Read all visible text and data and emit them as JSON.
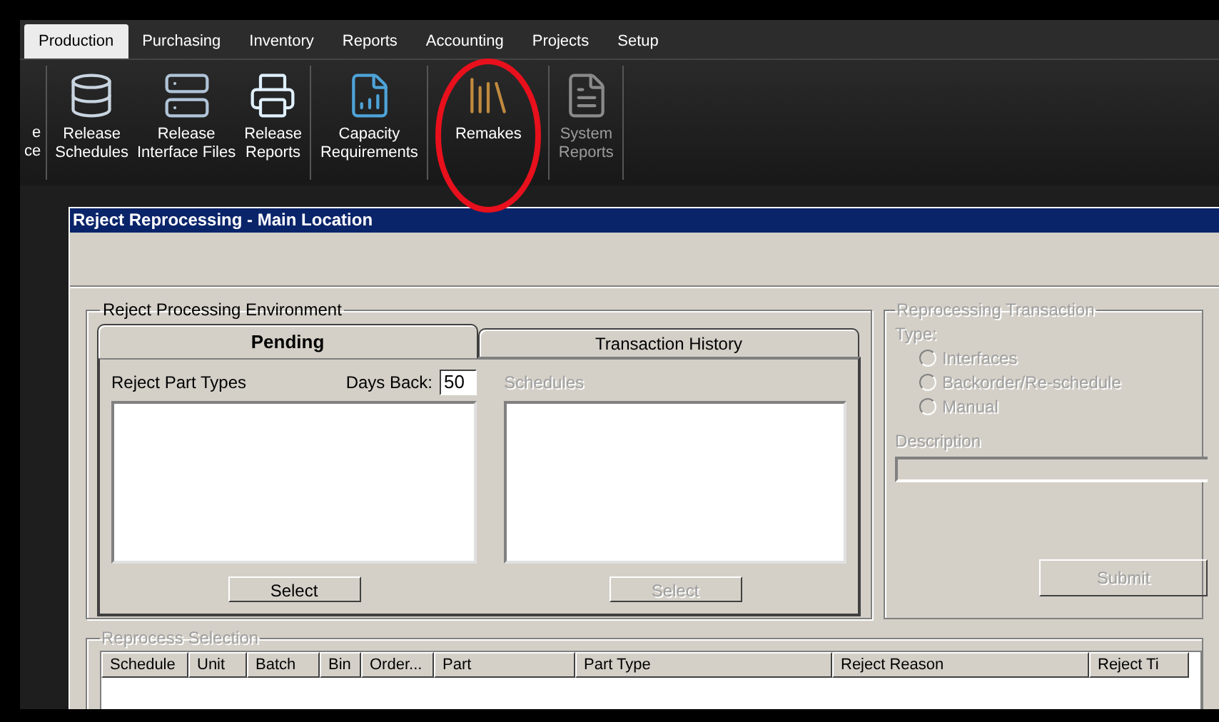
{
  "menu_tabs": [
    {
      "label": "Production",
      "selected": true
    },
    {
      "label": "Purchasing",
      "selected": false
    },
    {
      "label": "Inventory",
      "selected": false
    },
    {
      "label": "Reports",
      "selected": false
    },
    {
      "label": "Accounting",
      "selected": false
    },
    {
      "label": "Projects",
      "selected": false
    },
    {
      "label": "Setup",
      "selected": false
    }
  ],
  "toolbar_groups": [
    [
      {
        "kind": "cut",
        "lines": [
          "e",
          "ce"
        ],
        "disabled": false
      }
    ],
    [
      {
        "kind": "database",
        "lines": [
          "Release",
          "Schedules"
        ],
        "disabled": false
      },
      {
        "kind": "server",
        "lines": [
          "Release",
          "Interface Files"
        ],
        "disabled": false
      },
      {
        "kind": "printer",
        "lines": [
          "Release",
          "Reports"
        ],
        "disabled": false
      }
    ],
    [
      {
        "kind": "chart",
        "lines": [
          "Capacity",
          "Requirements"
        ],
        "disabled": false
      }
    ],
    [
      {
        "kind": "shelf",
        "lines": [
          "Remakes"
        ],
        "disabled": false,
        "circled": true
      }
    ],
    [
      {
        "kind": "document",
        "lines": [
          "System",
          "Reports"
        ],
        "disabled": true
      }
    ]
  ],
  "window": {
    "title": "Reject Reprocessing - Main Location",
    "environment": {
      "legend": "Reject Processing Environment",
      "tabs": [
        {
          "label": "Pending",
          "selected": true
        },
        {
          "label": "Transaction History",
          "selected": false
        }
      ],
      "part_types_label": "Reject Part Types",
      "days_back": {
        "label": "Days Back:",
        "value": "50"
      },
      "schedules_label": "Schedules",
      "schedules_disabled": true,
      "buttons": [
        {
          "label": "Select",
          "disabled": false
        },
        {
          "label": "Select",
          "disabled": true
        }
      ]
    },
    "transaction": {
      "legend": "Reprocessing Transaction",
      "disabled": true,
      "type_label": "Type:",
      "radios": [
        {
          "label": "Interfaces",
          "selected": false
        },
        {
          "label": "Backorder/Re-schedule",
          "selected": false
        },
        {
          "label": "Manual",
          "selected": false
        }
      ],
      "description_label": "Description",
      "submit": {
        "label": "Submit",
        "disabled": true
      }
    },
    "selection": {
      "legend": "Reprocess Selection",
      "disabled": true,
      "columns": [
        "Schedule",
        "Unit",
        "Batch",
        "Bin",
        "Order...",
        "Part",
        "Part Type",
        "Reject Reason",
        "Reject Ti"
      ]
    }
  }
}
